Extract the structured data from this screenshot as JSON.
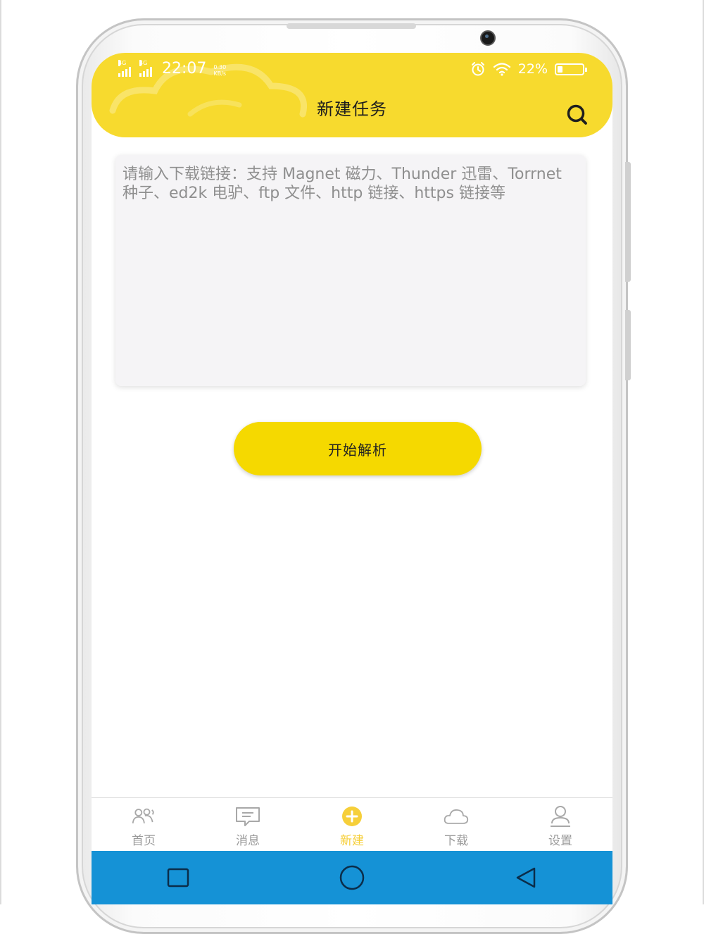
{
  "status_bar": {
    "signal1_label": "4G",
    "signal2_label": "4G",
    "time": "22:07",
    "speed_value": "0.30",
    "speed_unit": "KB/s",
    "battery_percent": "22%",
    "battery_level": 0.22
  },
  "header": {
    "title": "新建任务",
    "search_icon": "search-icon"
  },
  "link_input": {
    "placeholder": "请输入下载链接：支持 Magnet 磁力、Thunder 迅雷、Torrnet 种子、ed2k 电驴、ftp 文件、http 链接、https 链接等",
    "value": ""
  },
  "parse_button": {
    "label": "开始解析"
  },
  "tabs": [
    {
      "label": "首页",
      "icon": "users-icon",
      "active": false
    },
    {
      "label": "消息",
      "icon": "message-icon",
      "active": false
    },
    {
      "label": "新建",
      "icon": "add-circle-icon",
      "active": true
    },
    {
      "label": "下载",
      "icon": "cloud-icon",
      "active": false
    },
    {
      "label": "设置",
      "icon": "user-settings-icon",
      "active": false
    }
  ],
  "colors": {
    "accent_yellow": "#f7da2e",
    "button_yellow": "#f5d900",
    "active_tab": "#f6cf3a",
    "inactive_tab": "#9a9a9a",
    "nav_bar": "#1592d6"
  },
  "nav_bar": {
    "icons": [
      "recents-square-icon",
      "home-circle-icon",
      "back-triangle-icon"
    ]
  }
}
